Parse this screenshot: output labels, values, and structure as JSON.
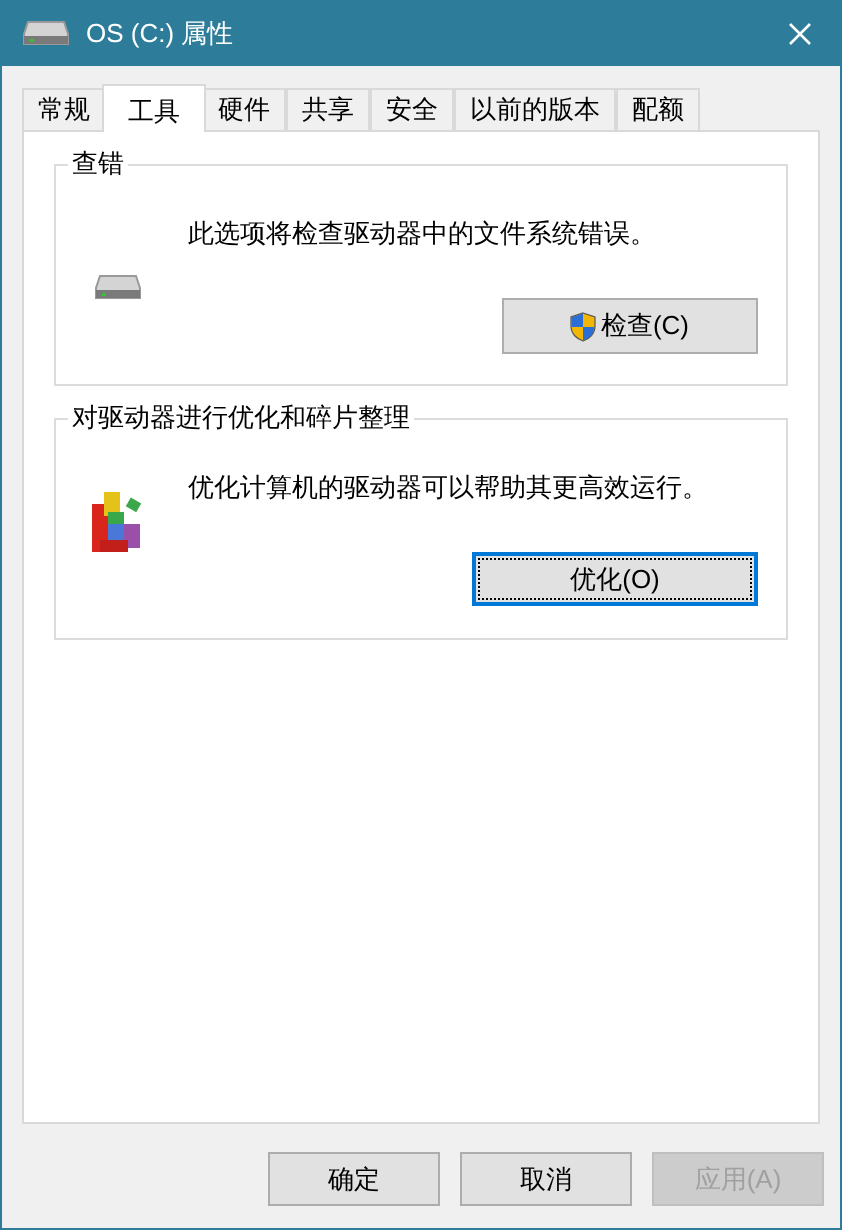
{
  "window": {
    "title": "OS (C:) 属性"
  },
  "tabs": [
    {
      "label": "常规",
      "selected": false
    },
    {
      "label": "工具",
      "selected": true
    },
    {
      "label": "硬件",
      "selected": false
    },
    {
      "label": "共享",
      "selected": false
    },
    {
      "label": "安全",
      "selected": false
    },
    {
      "label": "以前的版本",
      "selected": false
    },
    {
      "label": "配额",
      "selected": false
    }
  ],
  "groups": [
    {
      "kind": "check",
      "title": "查错",
      "description": "此选项将检查驱动器中的文件系统错误。",
      "button": {
        "label": "检查(C)",
        "focused": false
      }
    },
    {
      "kind": "optimize",
      "title": "对驱动器进行优化和碎片整理",
      "description": "优化计算机的驱动器可以帮助其更高效运行。",
      "button": {
        "label": "优化(O)",
        "focused": true
      }
    }
  ],
  "buttons": [
    {
      "label": "确定",
      "disabled": false
    },
    {
      "label": "取消",
      "disabled": false
    },
    {
      "label": "应用(A)",
      "disabled": true
    }
  ]
}
